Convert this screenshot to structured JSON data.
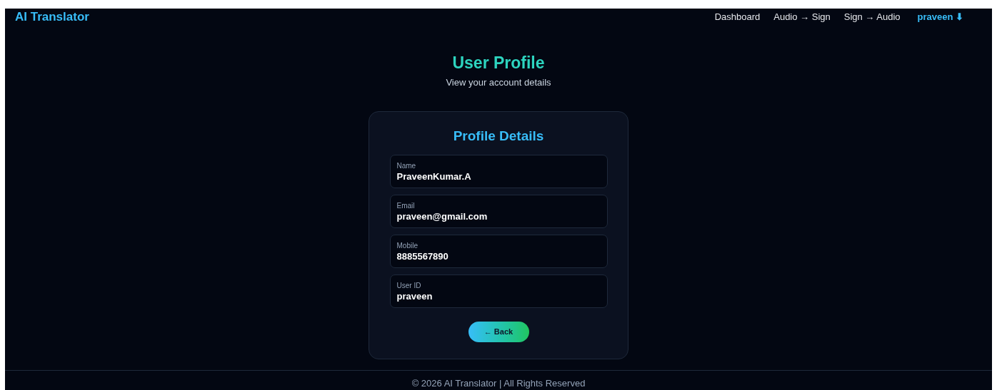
{
  "brand": "AI Translator",
  "nav": [
    {
      "label": "Dashboard",
      "kind": "link"
    },
    {
      "label": "Audio → Sign",
      "kind": "link"
    },
    {
      "label": "Sign → Audio",
      "kind": "link"
    },
    {
      "label": "praveen ⬇",
      "kind": "user"
    }
  ],
  "page": {
    "title": "User Profile",
    "subtitle": "View your account details"
  },
  "card": {
    "title": "Profile Details",
    "fields": [
      {
        "label": "Name",
        "value": "PraveenKumar.A"
      },
      {
        "label": "Email",
        "value": "praveen@gmail.com"
      },
      {
        "label": "Mobile",
        "value": "8885567890"
      },
      {
        "label": "User ID",
        "value": "praveen"
      }
    ],
    "back_button": "← Back"
  },
  "footer": "© 2026 AI Translator | All Rights Reserved"
}
